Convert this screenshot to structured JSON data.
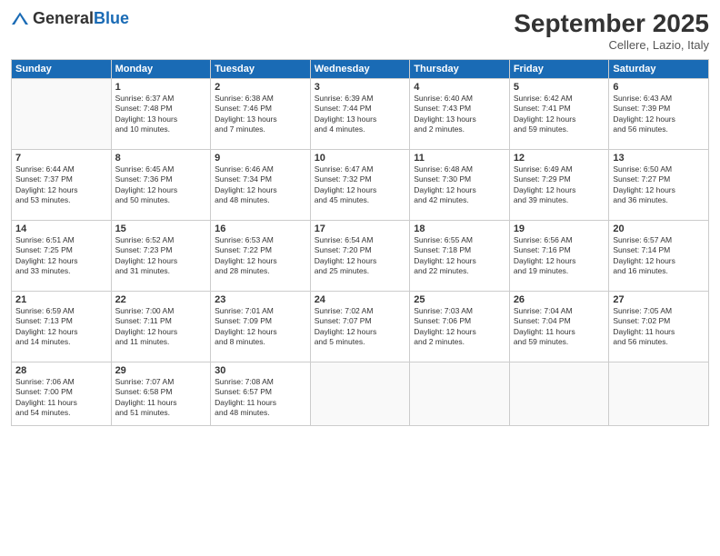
{
  "header": {
    "logo_general": "General",
    "logo_blue": "Blue",
    "month_title": "September 2025",
    "location": "Cellere, Lazio, Italy"
  },
  "days_of_week": [
    "Sunday",
    "Monday",
    "Tuesday",
    "Wednesday",
    "Thursday",
    "Friday",
    "Saturday"
  ],
  "weeks": [
    [
      {
        "day": "",
        "data": ""
      },
      {
        "day": "1",
        "data": "Sunrise: 6:37 AM\nSunset: 7:48 PM\nDaylight: 13 hours\nand 10 minutes."
      },
      {
        "day": "2",
        "data": "Sunrise: 6:38 AM\nSunset: 7:46 PM\nDaylight: 13 hours\nand 7 minutes."
      },
      {
        "day": "3",
        "data": "Sunrise: 6:39 AM\nSunset: 7:44 PM\nDaylight: 13 hours\nand 4 minutes."
      },
      {
        "day": "4",
        "data": "Sunrise: 6:40 AM\nSunset: 7:43 PM\nDaylight: 13 hours\nand 2 minutes."
      },
      {
        "day": "5",
        "data": "Sunrise: 6:42 AM\nSunset: 7:41 PM\nDaylight: 12 hours\nand 59 minutes."
      },
      {
        "day": "6",
        "data": "Sunrise: 6:43 AM\nSunset: 7:39 PM\nDaylight: 12 hours\nand 56 minutes."
      }
    ],
    [
      {
        "day": "7",
        "data": "Sunrise: 6:44 AM\nSunset: 7:37 PM\nDaylight: 12 hours\nand 53 minutes."
      },
      {
        "day": "8",
        "data": "Sunrise: 6:45 AM\nSunset: 7:36 PM\nDaylight: 12 hours\nand 50 minutes."
      },
      {
        "day": "9",
        "data": "Sunrise: 6:46 AM\nSunset: 7:34 PM\nDaylight: 12 hours\nand 48 minutes."
      },
      {
        "day": "10",
        "data": "Sunrise: 6:47 AM\nSunset: 7:32 PM\nDaylight: 12 hours\nand 45 minutes."
      },
      {
        "day": "11",
        "data": "Sunrise: 6:48 AM\nSunset: 7:30 PM\nDaylight: 12 hours\nand 42 minutes."
      },
      {
        "day": "12",
        "data": "Sunrise: 6:49 AM\nSunset: 7:29 PM\nDaylight: 12 hours\nand 39 minutes."
      },
      {
        "day": "13",
        "data": "Sunrise: 6:50 AM\nSunset: 7:27 PM\nDaylight: 12 hours\nand 36 minutes."
      }
    ],
    [
      {
        "day": "14",
        "data": "Sunrise: 6:51 AM\nSunset: 7:25 PM\nDaylight: 12 hours\nand 33 minutes."
      },
      {
        "day": "15",
        "data": "Sunrise: 6:52 AM\nSunset: 7:23 PM\nDaylight: 12 hours\nand 31 minutes."
      },
      {
        "day": "16",
        "data": "Sunrise: 6:53 AM\nSunset: 7:22 PM\nDaylight: 12 hours\nand 28 minutes."
      },
      {
        "day": "17",
        "data": "Sunrise: 6:54 AM\nSunset: 7:20 PM\nDaylight: 12 hours\nand 25 minutes."
      },
      {
        "day": "18",
        "data": "Sunrise: 6:55 AM\nSunset: 7:18 PM\nDaylight: 12 hours\nand 22 minutes."
      },
      {
        "day": "19",
        "data": "Sunrise: 6:56 AM\nSunset: 7:16 PM\nDaylight: 12 hours\nand 19 minutes."
      },
      {
        "day": "20",
        "data": "Sunrise: 6:57 AM\nSunset: 7:14 PM\nDaylight: 12 hours\nand 16 minutes."
      }
    ],
    [
      {
        "day": "21",
        "data": "Sunrise: 6:59 AM\nSunset: 7:13 PM\nDaylight: 12 hours\nand 14 minutes."
      },
      {
        "day": "22",
        "data": "Sunrise: 7:00 AM\nSunset: 7:11 PM\nDaylight: 12 hours\nand 11 minutes."
      },
      {
        "day": "23",
        "data": "Sunrise: 7:01 AM\nSunset: 7:09 PM\nDaylight: 12 hours\nand 8 minutes."
      },
      {
        "day": "24",
        "data": "Sunrise: 7:02 AM\nSunset: 7:07 PM\nDaylight: 12 hours\nand 5 minutes."
      },
      {
        "day": "25",
        "data": "Sunrise: 7:03 AM\nSunset: 7:06 PM\nDaylight: 12 hours\nand 2 minutes."
      },
      {
        "day": "26",
        "data": "Sunrise: 7:04 AM\nSunset: 7:04 PM\nDaylight: 11 hours\nand 59 minutes."
      },
      {
        "day": "27",
        "data": "Sunrise: 7:05 AM\nSunset: 7:02 PM\nDaylight: 11 hours\nand 56 minutes."
      }
    ],
    [
      {
        "day": "28",
        "data": "Sunrise: 7:06 AM\nSunset: 7:00 PM\nDaylight: 11 hours\nand 54 minutes."
      },
      {
        "day": "29",
        "data": "Sunrise: 7:07 AM\nSunset: 6:58 PM\nDaylight: 11 hours\nand 51 minutes."
      },
      {
        "day": "30",
        "data": "Sunrise: 7:08 AM\nSunset: 6:57 PM\nDaylight: 11 hours\nand 48 minutes."
      },
      {
        "day": "",
        "data": ""
      },
      {
        "day": "",
        "data": ""
      },
      {
        "day": "",
        "data": ""
      },
      {
        "day": "",
        "data": ""
      }
    ]
  ]
}
